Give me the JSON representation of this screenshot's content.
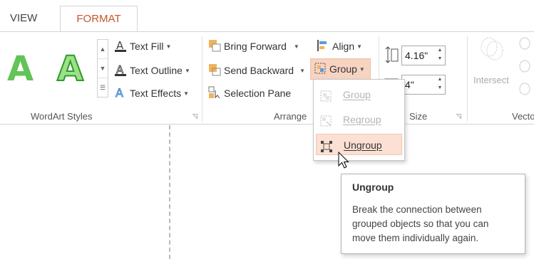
{
  "tabs": [
    {
      "label": "VIEW"
    },
    {
      "label": "FORMAT"
    }
  ],
  "wordart": {
    "sample_letter": "A",
    "commands": {
      "text_fill": "Text Fill",
      "text_outline": "Text Outline",
      "text_effects": "Text Effects"
    },
    "group_label": "WordArt Styles"
  },
  "arrange": {
    "bring_forward": "Bring Forward",
    "send_backward": "Send Backward",
    "selection_pane": "Selection Pane",
    "align": "Align",
    "group": "Group",
    "group_label": "Arrange"
  },
  "size": {
    "height_value": "4.16\"",
    "width_value": "4\"",
    "group_label": "Size"
  },
  "vector": {
    "intersect": "Intersect",
    "group_label_partial": "Vecto"
  },
  "group_menu": {
    "items": [
      {
        "label": "Group",
        "enabled": false
      },
      {
        "label": "Regroup",
        "enabled": false
      },
      {
        "label": "Ungroup",
        "enabled": true,
        "highlighted": true
      }
    ]
  },
  "tooltip": {
    "title": "Ungroup",
    "body": "Break the connection between grouped objects so that you can move them individually again."
  },
  "colors": {
    "accent": "#c4572a",
    "highlight": "#f7d3c1",
    "menu_highlight": "#fbe0d3",
    "wordart_green": "#62c458"
  }
}
